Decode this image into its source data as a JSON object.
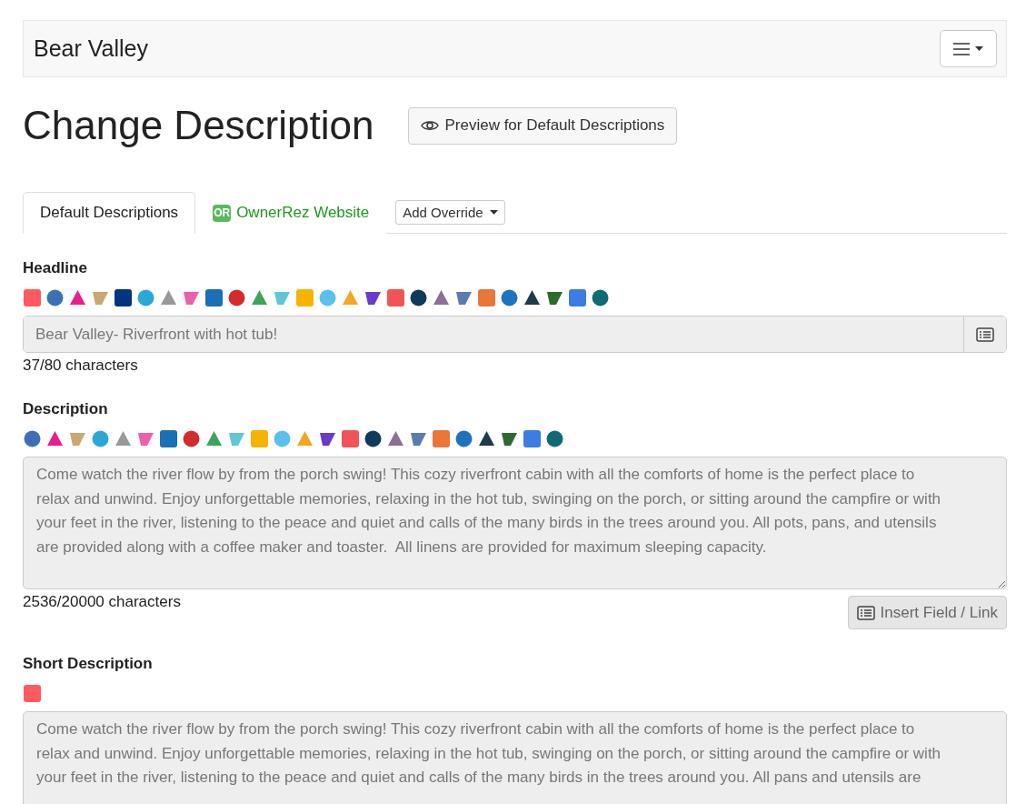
{
  "navbar": {
    "brand": "Bear Valley"
  },
  "page_title": "Change Description",
  "preview_button": "Preview for Default Descriptions",
  "tabs": [
    {
      "label": "Default Descriptions",
      "selected": true,
      "kind": "plain"
    },
    {
      "label": "OwnerRez Website",
      "selected": false,
      "kind": "website",
      "badge": "OR"
    }
  ],
  "add_override": "Add Override",
  "headline": {
    "label": "Headline",
    "value": "Bear Valley- Riverfront with hot tub!",
    "count": "37/80 characters"
  },
  "description": {
    "label": "Description",
    "value": "Come watch the river flow by from the porch swing! This cozy riverfront cabin with all the comforts of home is the perfect place to relax and unwind. Enjoy unforgettable memories, relaxing in the hot tub, swinging on the porch, or sitting around the campfire or with your feet in the river, listening to the peace and quiet and calls of the many birds in the trees around you. All pots, pans, and utensils are provided along with a coffee maker and toaster.  All linens are provided for maximum sleeping capacity.",
    "count": "2536/20000 characters",
    "insert_button": "Insert Field / Link"
  },
  "short_description": {
    "label": "Short Description",
    "value": "Come watch the river flow by from the porch swing! This cozy riverfront cabin with all the comforts of home is the perfect place to relax and unwind. Enjoy unforgettable memories, relaxing in the hot tub, swinging on the porch, or sitting around the campfire or with your feet in the river, listening to the peace and quiet and calls of the many birds in the trees around you. All pans and utensils are"
  }
}
